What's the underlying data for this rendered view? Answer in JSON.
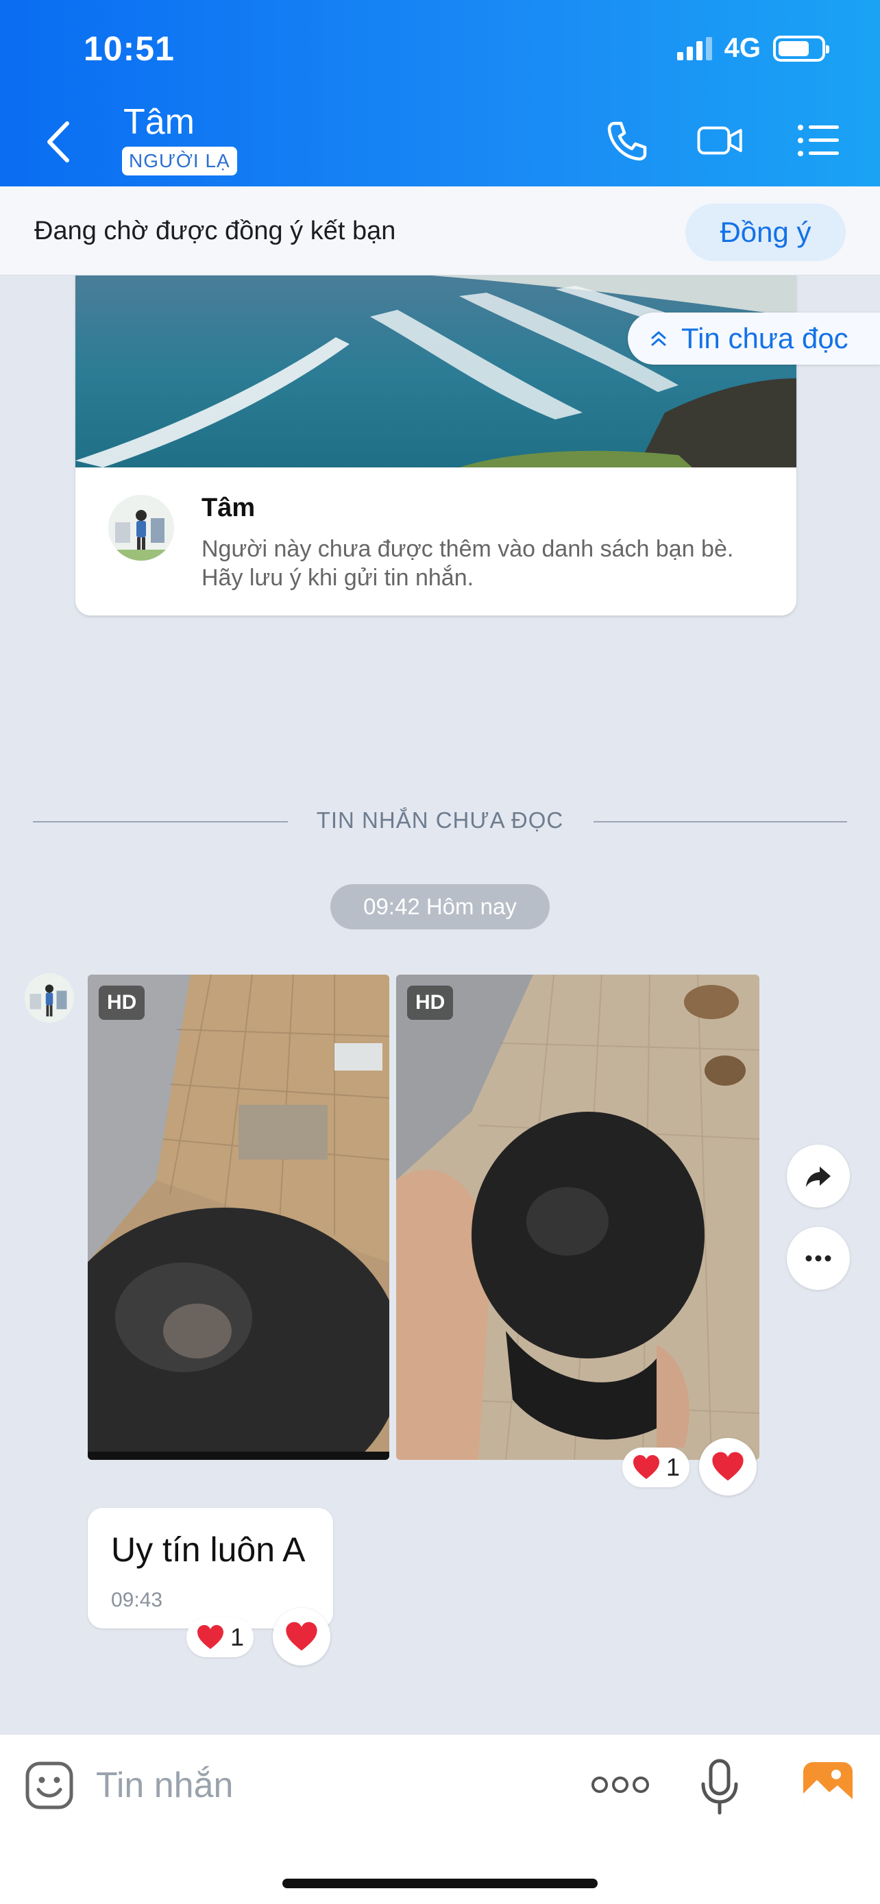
{
  "status_bar": {
    "time": "10:51",
    "network": "4G"
  },
  "header": {
    "contact_name": "Tâm",
    "badge": "NGƯỜI LẠ"
  },
  "pending": {
    "text": "Đang chờ được đồng ý kết bạn",
    "accept_label": "Đồng ý"
  },
  "unread_jump": {
    "label": "Tin chưa đọc"
  },
  "profile_card": {
    "name": "Tâm",
    "note": "Người này chưa được thêm vào danh sách bạn bè. Hãy lưu ý khi gửi tin nhắn."
  },
  "divider": {
    "label": "TIN NHẮN CHƯA ĐỌC"
  },
  "time_chip": "09:42 Hôm nay",
  "photos": {
    "badge1": "HD",
    "badge2": "HD",
    "reaction_count": "1"
  },
  "text_message": {
    "text": "Uy tín luôn A",
    "time": "09:43",
    "reaction_count": "1"
  },
  "composer": {
    "placeholder": "Tin nhắn"
  },
  "colors": {
    "header_blue": "#0a6df2",
    "accent": "#1472e6",
    "heart": "#e8283a",
    "gallery_orange": "#f6922e"
  }
}
